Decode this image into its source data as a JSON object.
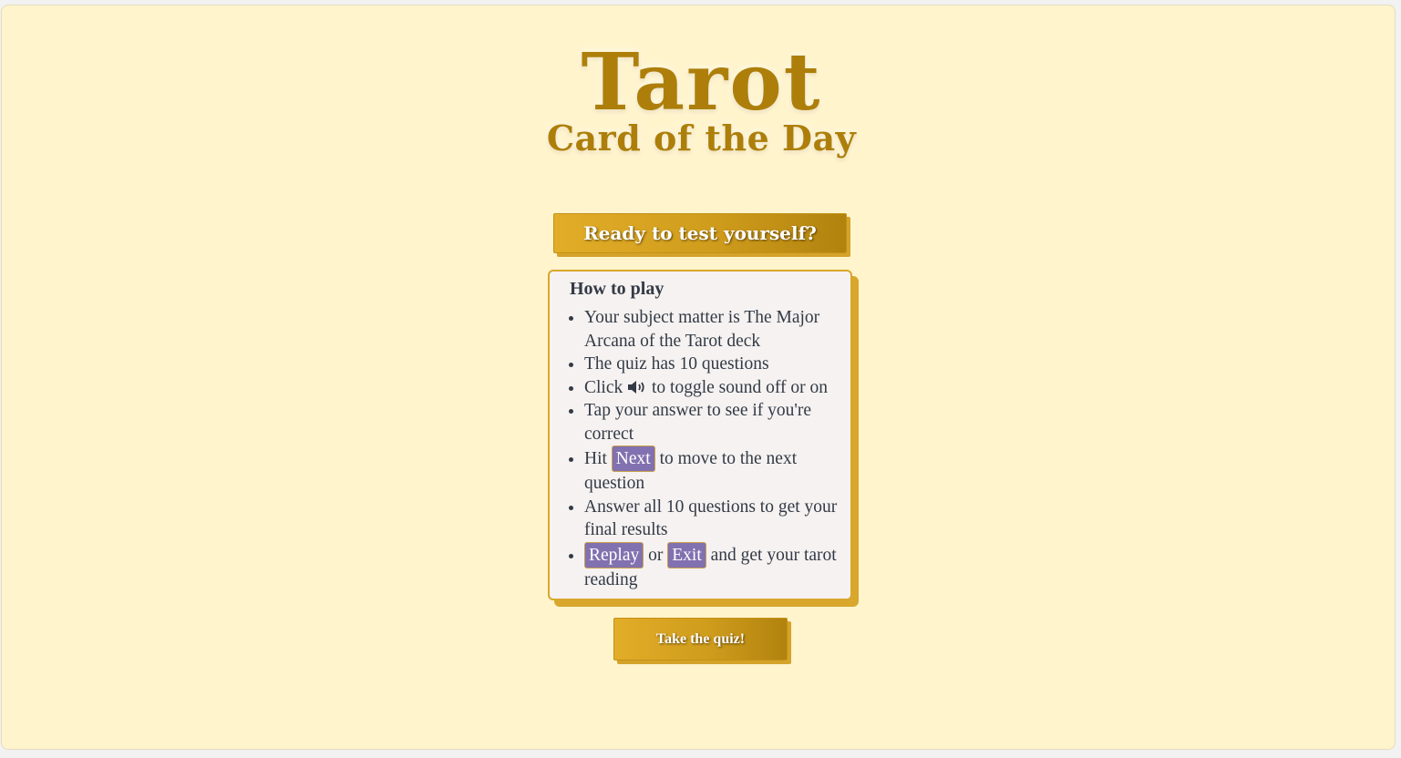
{
  "logo": {
    "title": "Tarot",
    "subtitle": "Card of the Day"
  },
  "intro": {
    "heading": "Ready to test yourself?"
  },
  "rules": {
    "title": "How to play",
    "items": [
      {
        "text": "Your subject matter is The Major Arcana of the Tarot deck"
      },
      {
        "text": "The quiz has 10 questions"
      },
      {
        "before": "Click",
        "icon": "speaker-icon",
        "after": "to toggle sound off or on"
      },
      {
        "text": "Tap your answer to see if you're correct"
      },
      {
        "before": "Hit",
        "pill": "Next",
        "after": "to move to the next question"
      },
      {
        "text": "Answer all 10 questions to get your final results"
      },
      {
        "pill1": "Replay",
        "middle": "or",
        "pill2": "Exit",
        "after": "and get your tarot reading"
      }
    ]
  },
  "actions": {
    "start_label": "Take the quiz!"
  },
  "colors": {
    "background": "#fff4cc",
    "gold": "#d8a72c",
    "gold_dark": "#ad7f0a",
    "pill_purple": "#8271b0",
    "text": "#333a45",
    "card": "#f5f2f1"
  }
}
